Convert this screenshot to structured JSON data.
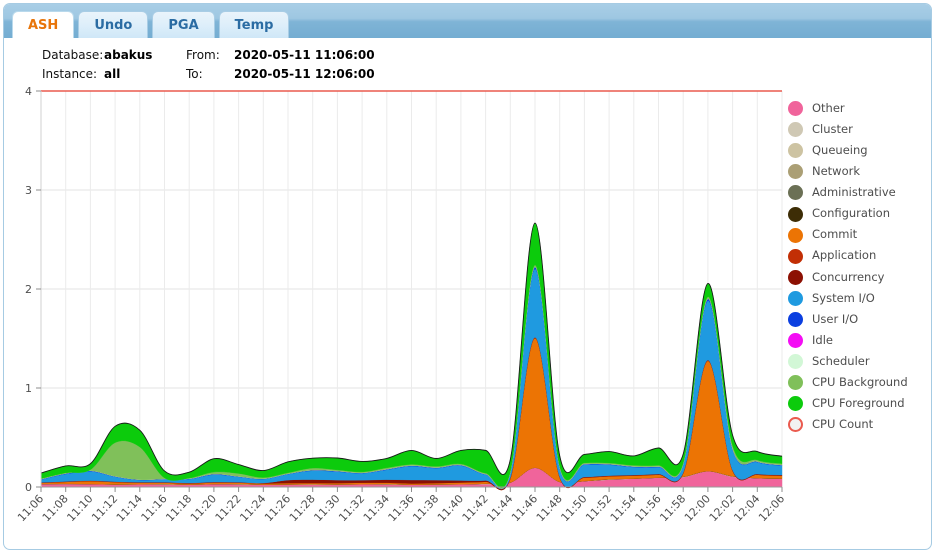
{
  "window": {
    "tabs": [
      {
        "label": "ASH",
        "active": true
      },
      {
        "label": "Undo",
        "active": false
      },
      {
        "label": "PGA",
        "active": false
      },
      {
        "label": "Temp",
        "active": false
      }
    ]
  },
  "header": {
    "database_label": "Database:",
    "database_value": "abakus",
    "instance_label": "Instance:",
    "instance_value": "all",
    "from_label": "From:",
    "from_value": "2020-05-11 11:06:00",
    "to_label": "To:",
    "to_value": "2020-05-11 12:06:00"
  },
  "chart_data": {
    "type": "area",
    "stacked": true,
    "title": "",
    "xlabel": "",
    "ylabel": "",
    "ylim": [
      0,
      4
    ],
    "yticks": [
      0,
      1,
      2,
      3,
      4
    ],
    "grid": true,
    "legend_position": "right",
    "x": [
      "11:06",
      "11:08",
      "11:10",
      "11:12",
      "11:14",
      "11:16",
      "11:18",
      "11:20",
      "11:22",
      "11:24",
      "11:26",
      "11:28",
      "11:30",
      "11:32",
      "11:34",
      "11:36",
      "11:38",
      "11:40",
      "11:42",
      "11:44",
      "11:46",
      "11:48",
      "11:50",
      "11:52",
      "11:54",
      "11:56",
      "11:58",
      "12:00",
      "12:02",
      "12:04",
      "12:06"
    ],
    "xticks": [
      "11:06",
      "11:08",
      "11:10",
      "11:12",
      "11:14",
      "11:16",
      "11:18",
      "11:20",
      "11:22",
      "11:24",
      "11:26",
      "11:28",
      "11:30",
      "11:32",
      "11:34",
      "11:36",
      "11:38",
      "11:40",
      "11:42",
      "11:44",
      "11:46",
      "11:48",
      "11:50",
      "11:52",
      "11:54",
      "11:56",
      "11:58",
      "12:00",
      "12:02",
      "12:04",
      "12:06"
    ],
    "series": [
      {
        "name": "Other",
        "color": "#f0649b",
        "values": [
          0.03,
          0.032,
          0.03,
          0.026,
          0.028,
          0.026,
          0.024,
          0.03,
          0.026,
          0.024,
          0.026,
          0.024,
          0.026,
          0.028,
          0.026,
          0.024,
          0.026,
          0.028,
          0.03,
          0.045,
          0.195,
          0.052,
          0.06,
          0.075,
          0.085,
          0.095,
          0.1,
          0.16,
          0.105,
          0.09,
          0.085
        ]
      },
      {
        "name": "Cluster",
        "color": "#cfc8b4",
        "values": [
          0,
          0,
          0,
          0,
          0,
          0,
          0,
          0,
          0,
          0,
          0,
          0,
          0,
          0,
          0,
          0,
          0,
          0,
          0,
          0,
          0,
          0,
          0,
          0,
          0,
          0,
          0,
          0,
          0,
          0,
          0
        ]
      },
      {
        "name": "Queueing",
        "color": "#cdc3a2",
        "values": [
          0,
          0,
          0,
          0,
          0,
          0,
          0,
          0,
          0,
          0,
          0,
          0,
          0,
          0,
          0,
          0,
          0,
          0,
          0,
          0,
          0,
          0,
          0,
          0,
          0,
          0,
          0,
          0,
          0,
          0,
          0
        ]
      },
      {
        "name": "Network",
        "color": "#ab9f75",
        "values": [
          0,
          0,
          0,
          0,
          0,
          0.004,
          0,
          0,
          0.004,
          0,
          0,
          0.004,
          0,
          0,
          0.004,
          0,
          0,
          0,
          0.004,
          0,
          0,
          0,
          0,
          0.004,
          0,
          0,
          0.004,
          0,
          0.004,
          0,
          0
        ]
      },
      {
        "name": "Administrative",
        "color": "#6b7055",
        "values": [
          0,
          0,
          0,
          0,
          0,
          0,
          0,
          0,
          0,
          0,
          0,
          0,
          0,
          0,
          0,
          0,
          0,
          0,
          0,
          0,
          0,
          0,
          0,
          0,
          0,
          0,
          0,
          0,
          0,
          0,
          0
        ]
      },
      {
        "name": "Configuration",
        "color": "#3d2d06",
        "values": [
          0,
          0,
          0,
          0,
          0,
          0,
          0,
          0,
          0,
          0,
          0,
          0,
          0,
          0,
          0,
          0,
          0,
          0,
          0,
          0,
          0,
          0,
          0,
          0,
          0,
          0,
          0,
          0,
          0,
          0,
          0
        ]
      },
      {
        "name": "Commit",
        "color": "#ec7404",
        "values": [
          0.012,
          0.02,
          0.03,
          0.024,
          0.016,
          0.014,
          0.012,
          0.016,
          0.014,
          0.012,
          0.014,
          0.012,
          0.014,
          0.016,
          0.014,
          0.012,
          0.014,
          0.018,
          0.02,
          0.04,
          1.31,
          0.045,
          0.035,
          0.03,
          0.03,
          0.03,
          0.035,
          1.115,
          0.055,
          0.035,
          0.03
        ]
      },
      {
        "name": "Application",
        "color": "#c22f05",
        "values": [
          0,
          0,
          0,
          0,
          0,
          0,
          0,
          0,
          0,
          0,
          0,
          0,
          0,
          0,
          0,
          0,
          0,
          0,
          0,
          0,
          0,
          0,
          0,
          0,
          0,
          0,
          0,
          0,
          0,
          0,
          0
        ]
      },
      {
        "name": "Concurrency",
        "color": "#8c1003",
        "values": [
          0.004,
          0.004,
          0.004,
          0.004,
          0.004,
          0.004,
          0.004,
          0.004,
          0.004,
          0.004,
          0.03,
          0.035,
          0.03,
          0.025,
          0.03,
          0.035,
          0.03,
          0.02,
          0.012,
          0.008,
          0.006,
          0.006,
          0.006,
          0.006,
          0.006,
          0.006,
          0.006,
          0.006,
          0.006,
          0.006,
          0.006
        ]
      },
      {
        "name": "System I/O",
        "color": "#1f9ae0",
        "values": [
          0.03,
          0.075,
          0.095,
          0.05,
          0.022,
          0.03,
          0.04,
          0.075,
          0.055,
          0.04,
          0.06,
          0.09,
          0.085,
          0.07,
          0.1,
          0.14,
          0.12,
          0.15,
          0.06,
          0.05,
          0.69,
          0.09,
          0.125,
          0.11,
          0.08,
          0.07,
          0.08,
          0.6,
          0.21,
          0.12,
          0.095
        ]
      },
      {
        "name": "User I/O",
        "color": "#0b3fe0",
        "values": [
          0.004,
          0.006,
          0.006,
          0.004,
          0.004,
          0.004,
          0.004,
          0.006,
          0.004,
          0.004,
          0.004,
          0.006,
          0.006,
          0.004,
          0.006,
          0.006,
          0.006,
          0.006,
          0.004,
          0.004,
          0.02,
          0.006,
          0.006,
          0.006,
          0.006,
          0.006,
          0.006,
          0.02,
          0.008,
          0.006,
          0.006
        ]
      },
      {
        "name": "Idle",
        "color": "#f40df4",
        "values": [
          0,
          0,
          0,
          0,
          0,
          0,
          0,
          0,
          0,
          0,
          0,
          0,
          0,
          0,
          0,
          0,
          0,
          0,
          0,
          0,
          0,
          0,
          0,
          0,
          0,
          0,
          0,
          0,
          0,
          0,
          0
        ]
      },
      {
        "name": "Scheduler",
        "color": "#d2f7d6",
        "values": [
          0,
          0,
          0,
          0,
          0,
          0,
          0,
          0,
          0,
          0,
          0,
          0,
          0,
          0,
          0,
          0,
          0,
          0,
          0,
          0,
          0,
          0,
          0,
          0,
          0,
          0,
          0,
          0,
          0,
          0,
          0
        ]
      },
      {
        "name": "CPU Background",
        "color": "#80c05a",
        "values": [
          0.006,
          0.006,
          0.01,
          0.34,
          0.33,
          0.01,
          0.006,
          0.02,
          0.03,
          0.012,
          0.01,
          0.02,
          0.012,
          0.01,
          0.014,
          0.012,
          0.012,
          0.012,
          0.01,
          0.01,
          0.02,
          0.012,
          0.012,
          0.012,
          0.012,
          0.012,
          0.012,
          0.02,
          0.03,
          0.016,
          0.014
        ]
      },
      {
        "name": "CPU Foreground",
        "color": "#0ccb0c",
        "values": [
          0.055,
          0.07,
          0.06,
          0.165,
          0.17,
          0.07,
          0.06,
          0.135,
          0.09,
          0.07,
          0.11,
          0.1,
          0.12,
          0.105,
          0.095,
          0.14,
          0.08,
          0.135,
          0.23,
          0.12,
          0.425,
          0.105,
          0.085,
          0.115,
          0.095,
          0.175,
          0.09,
          0.135,
          0.105,
          0.085,
          0.075
        ]
      },
      {
        "name": "CPU Count",
        "color": "#ea5a4e",
        "kind": "line",
        "values": [
          4,
          4,
          4,
          4,
          4,
          4,
          4,
          4,
          4,
          4,
          4,
          4,
          4,
          4,
          4,
          4,
          4,
          4,
          4,
          4,
          4,
          4,
          4,
          4,
          4,
          4,
          4,
          4,
          4,
          4,
          4
        ]
      }
    ],
    "legend": [
      {
        "name": "Other",
        "color": "#f0649b",
        "hollow": false
      },
      {
        "name": "Cluster",
        "color": "#cfc8b4",
        "hollow": false
      },
      {
        "name": "Queueing",
        "color": "#cdc3a2",
        "hollow": false
      },
      {
        "name": "Network",
        "color": "#ab9f75",
        "hollow": false
      },
      {
        "name": "Administrative",
        "color": "#6b7055",
        "hollow": false
      },
      {
        "name": "Configuration",
        "color": "#3d2d06",
        "hollow": false
      },
      {
        "name": "Commit",
        "color": "#ec7404",
        "hollow": false
      },
      {
        "name": "Application",
        "color": "#c22f05",
        "hollow": false
      },
      {
        "name": "Concurrency",
        "color": "#8c1003",
        "hollow": false
      },
      {
        "name": "System I/O",
        "color": "#1f9ae0",
        "hollow": false
      },
      {
        "name": "User I/O",
        "color": "#0b3fe0",
        "hollow": false
      },
      {
        "name": "Idle",
        "color": "#f40df4",
        "hollow": false
      },
      {
        "name": "Scheduler",
        "color": "#d2f7d6",
        "hollow": false
      },
      {
        "name": "CPU Background",
        "color": "#80c05a",
        "hollow": false
      },
      {
        "name": "CPU Foreground",
        "color": "#0ccb0c",
        "hollow": false
      },
      {
        "name": "CPU Count",
        "color": "#ea5a4e",
        "hollow": true
      }
    ]
  }
}
